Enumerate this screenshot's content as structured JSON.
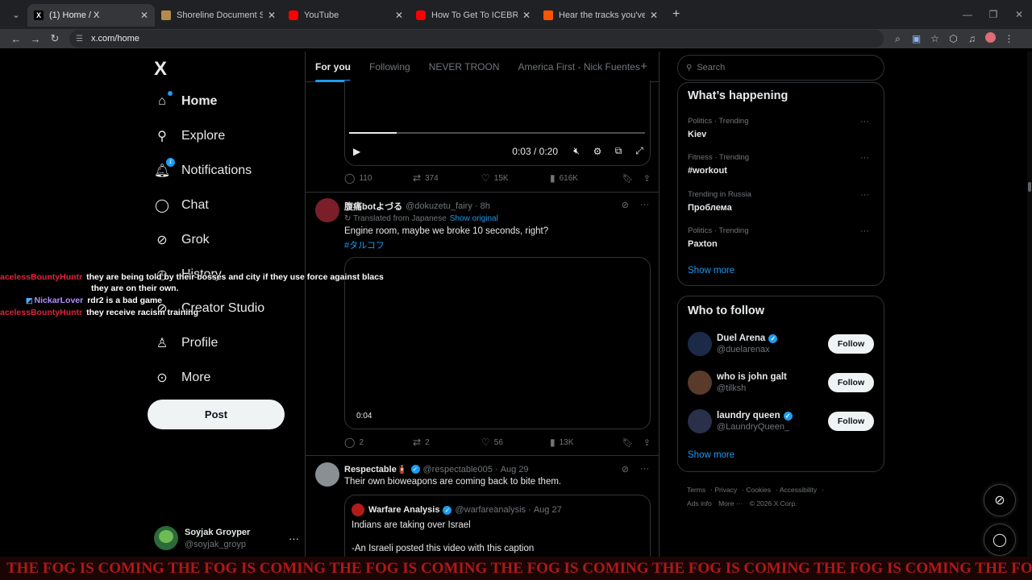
{
  "browser": {
    "tabs": [
      {
        "title": "(1) Home / X",
        "fav": "X",
        "fav_color": "#000000"
      },
      {
        "title": "Shoreline Document Spawn Ma",
        "fav": "",
        "fav_color": "#b58b4c"
      },
      {
        "title": "YouTube",
        "fav": "",
        "fav_color": "#ff0000"
      },
      {
        "title": "How To Get To ICEBREAKER In",
        "fav": "",
        "fav_color": "#ff0000"
      },
      {
        "title": "Hear the tracks you've liked: on",
        "fav": "",
        "fav_color": "#ff5500"
      }
    ],
    "url": "x.com/home"
  },
  "nav": {
    "logo": "X",
    "items": [
      {
        "label": "Home",
        "icon": "home-icon"
      },
      {
        "label": "Explore",
        "icon": "search-icon"
      },
      {
        "label": "Notifications",
        "icon": "bell-icon",
        "badge": "1"
      },
      {
        "label": "Chat",
        "icon": "chat-icon"
      },
      {
        "label": "Grok",
        "icon": "grok-icon"
      },
      {
        "label": "History",
        "icon": "history-icon"
      },
      {
        "label": "Creator Studio",
        "icon": "creator-icon"
      },
      {
        "label": "Profile",
        "icon": "person-icon"
      },
      {
        "label": "More",
        "icon": "more-circle-icon"
      }
    ],
    "post_label": "Post",
    "account": {
      "name": "Soyjak Groyper",
      "handle": "@soyjak_groyp"
    }
  },
  "feed": {
    "tabs": [
      "For you",
      "Following",
      "NEVER TROON",
      "America First - Nick Fuentes"
    ],
    "video_top": {
      "time": "0:03 / 0:20",
      "progress": 0.16
    },
    "actions_1": {
      "replies": "110",
      "reposts": "374",
      "likes": "15K",
      "views": "616K"
    },
    "tweet_2": {
      "name": "腹痛botよづる",
      "handle": "@dokuzetu_fairy",
      "time": "8h",
      "translated": "Translated from Japanese",
      "show_original": "Show original",
      "text": "Engine room, maybe we broke 10 seconds, right?",
      "hashtag": "#タルコフ",
      "duration": "0:04",
      "replies": "2",
      "reposts": "2",
      "likes": "56",
      "views": "13K"
    },
    "tweet_3": {
      "name": "Respectable🧯",
      "handle": "@respectable005",
      "time": "Aug 29",
      "text": "Their own bioweapons are coming back to bite them.",
      "quote": {
        "name": "Warfare Analysis",
        "handle": "@warfareanalysis",
        "time": "Aug 27",
        "line1": "Indians are taking over Israel",
        "line2": "-An Israeli posted this video with this caption"
      }
    }
  },
  "sidebar": {
    "search_placeholder": "Search",
    "happening_title": "What’s happening",
    "trends": [
      {
        "context": "Politics · Trending",
        "topic": "Kiev"
      },
      {
        "context": "Fitness · Trending",
        "topic": "#workout"
      },
      {
        "context": "Trending in Russia",
        "topic": "Проблема"
      },
      {
        "context": "Politics · Trending",
        "topic": "Paxton"
      }
    ],
    "show_more": "Show more",
    "follow_title": "Who to follow",
    "follow": [
      {
        "name": "Duel Arena",
        "handle": "@duelarenax",
        "verified": true,
        "color": "#1c2a4a"
      },
      {
        "name": "who is john galt",
        "handle": "@tilksh",
        "verified": false,
        "color": "#5a3a2a"
      },
      {
        "name": "laundry queen",
        "handle": "@LaundryQueen_",
        "verified": true,
        "color": "#2a2f4a"
      }
    ],
    "follow_label": "Follow",
    "footer": [
      "Terms",
      "Privacy",
      "Cookies",
      "Accessibility",
      "Ads info",
      "More ···",
      "© 2026 X Corp."
    ]
  },
  "overlay": {
    "chat": [
      {
        "user": "acelessBountyHuntr",
        "color": "#e0243b",
        "msg": "they are being told by their bosses and city if they use force against blacs"
      },
      {
        "user": "",
        "color": "#e0243b",
        "msg": "they are on their own."
      },
      {
        "user": "NickarLover",
        "color": "#b48cff",
        "msg": "rdr2 is a bad game"
      },
      {
        "user": "acelessBountyHuntr",
        "color": "#e0243b",
        "msg": "they receive racism training"
      }
    ],
    "fog": "THE FOG IS COMING THE FOG IS COMING THE FOG IS COMING THE FOG IS COMING THE FOG IS COMING THE FOG IS COMING THE FOG IS COMING"
  }
}
